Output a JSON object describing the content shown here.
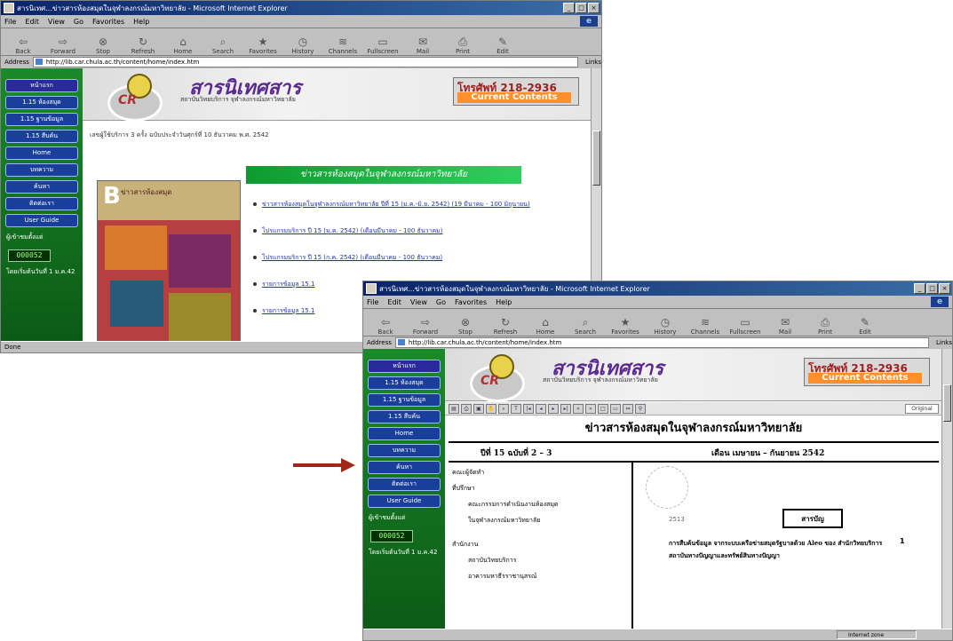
{
  "window1": {
    "title": "สารนิเทศ...ข่าวสารห้องสมุดในจุฬาลงกรณ์มหาวิทยาลัย - Microsoft Internet Explorer",
    "menu": [
      "File",
      "Edit",
      "View",
      "Go",
      "Favorites",
      "Help"
    ],
    "toolbar": [
      "Back",
      "Forward",
      "Stop",
      "Refresh",
      "Home",
      "Search",
      "Favorites",
      "History",
      "Channels",
      "Fullscreen",
      "Mail",
      "Print",
      "Edit"
    ],
    "address_label": "Address",
    "address_url": "http://lib.car.chula.ac.th/content/home/index.htm",
    "links_label": "Links",
    "status": "Done",
    "visitor_text": "เลขผู้ใช้บริการ 3 ครั้ง ฉบับประจำวันศุกร์ที่ 10 ธันวาคม พ.ศ. 2542",
    "green_header": "ข่าวสารห้องสมุดในจุฬาลงกรณ์มหาวิทยาลัย",
    "links": [
      "ข่าวสารห้องสมุดในจุฬาลงกรณ์มหาวิทยาลัย ปีที่ 15 (ม.ค.-มิ.ย. 2542)  (19 มีนาคม - 100 มิถุนายน)",
      "โปรแกรมบริการ ปี 15 (ม.ค. 2542)  (เดือนมีนาคม - 100 ธันวาคม)",
      "โปรแกรมบริการ ปี 15 (ก.ค. 2542)  (เดือนมีนาคม - 100 ธันวาคม)",
      "รายการข้อมูล 15.1",
      "รายการข้อมูล 15.1"
    ],
    "cover_label": "ข่าวสารห้องสมุด"
  },
  "window2": {
    "title": "สารนิเทศ...ข่าวสารห้องสมุดในจุฬาลงกรณ์มหาวิทยาลัย - Microsoft Internet Explorer",
    "address_url": "http://lib.car.chula.ac.th/content/home/index.htm",
    "status_zone": "Internet zone",
    "zoom": "Original",
    "doc_title": "ข่าวสารห้องสมุดในจุฬาลงกรณ์มหาวิทยาลัย",
    "doc_volume": "ปีที่ 15 ฉบับที่ 2 – 3",
    "doc_date": "เดือน เมษายน – กันยายน 2542",
    "left_col": {
      "editors": "คณะผู้จัดทำ",
      "advisor": "ที่ปรึกษา",
      "advisor_line1": "คณะกรรมการดำเนินงานห้องสมุด",
      "advisor_line2": "ในจุฬาลงกรณ์มหาวิทยาลัย",
      "office": "สำนักงาน",
      "office_line1": "สถาบันวิทยบริการ",
      "office_line2": "อาคารมหาธีรราชานุสรณ์"
    },
    "year_text": "2513",
    "toc_label": "สารบัญ",
    "toc_entry": "การสืบค้นข้อมูล จากระบบเครือข่ายสมุดรัฐบาลด้วย Aleo ของ สำนักวิทยบริการ สถาบันทางปัญญาและทรัพย์สินทางปัญญา",
    "toc_page": "1"
  },
  "sidebar": {
    "buttons": [
      "หน้าแรก",
      "1.15 ห้องสมุด",
      "1.15 ฐานข้อมูล",
      "1.15 สืบค้น",
      "Home",
      "บทความ",
      "ค้นหา",
      "ติดต่อเรา",
      "User Guide"
    ],
    "count_label": "ผู้เข้าชมตั้งแต่",
    "counter": "000052",
    "footer_text": "โดยเริ่มต้นวันที่ 1 ม.ค.42"
  },
  "banner": {
    "title": "สารนิเทศสาร",
    "subtitle": "สถาบันวิทยบริการ จุฬาลงกรณ์มหาวิทยาลัย",
    "phone": "โทรศัพท์ 218-2936",
    "current": "Current Contents"
  },
  "colors": {
    "arrow": "#a02818",
    "sidebar": "#1a8a2a",
    "link": "#2030c0",
    "ie_title": "#0a246a"
  }
}
